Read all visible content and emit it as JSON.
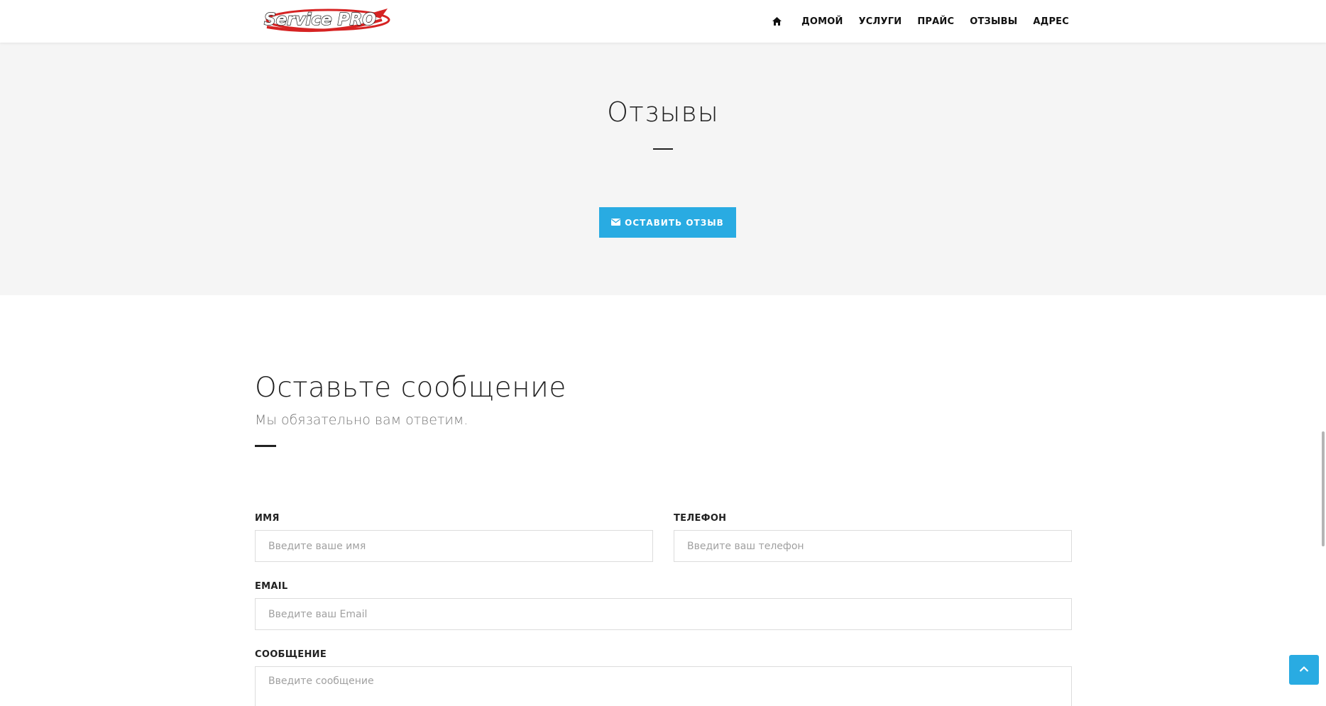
{
  "header": {
    "logo_text": "Service PRO",
    "nav": {
      "home_icon": "home-icon",
      "items": [
        {
          "label": "ДОМОЙ"
        },
        {
          "label": "УСЛУГИ"
        },
        {
          "label": "ПРАЙС"
        },
        {
          "label": "ОТЗЫВЫ"
        },
        {
          "label": "АДРЕС"
        }
      ]
    }
  },
  "reviews": {
    "title": "Отзывы",
    "button_label": "ОСТАВИТЬ ОТЗЫВ",
    "button_icon": "envelope-icon"
  },
  "contact": {
    "title": "Оставьте сообщение",
    "subtitle": "Мы обязательно вам ответим.",
    "fields": {
      "name": {
        "label": "ИМЯ",
        "placeholder": "Введите ваше имя",
        "value": ""
      },
      "phone": {
        "label": "ТЕЛЕФОН",
        "placeholder": "Введите ваш телефон",
        "value": ""
      },
      "email": {
        "label": "EMAIL",
        "placeholder": "Введите ваш Email",
        "value": ""
      },
      "message": {
        "label": "СООБЩЕНИЕ",
        "placeholder": "Введите сообщение",
        "value": ""
      }
    }
  },
  "scroll_to_top": {
    "icon": "chevron-up-icon"
  },
  "colors": {
    "accent": "#29abe2",
    "section_bg": "#f5f5f5",
    "logo_red": "#d62323",
    "text_dark": "#222222"
  }
}
